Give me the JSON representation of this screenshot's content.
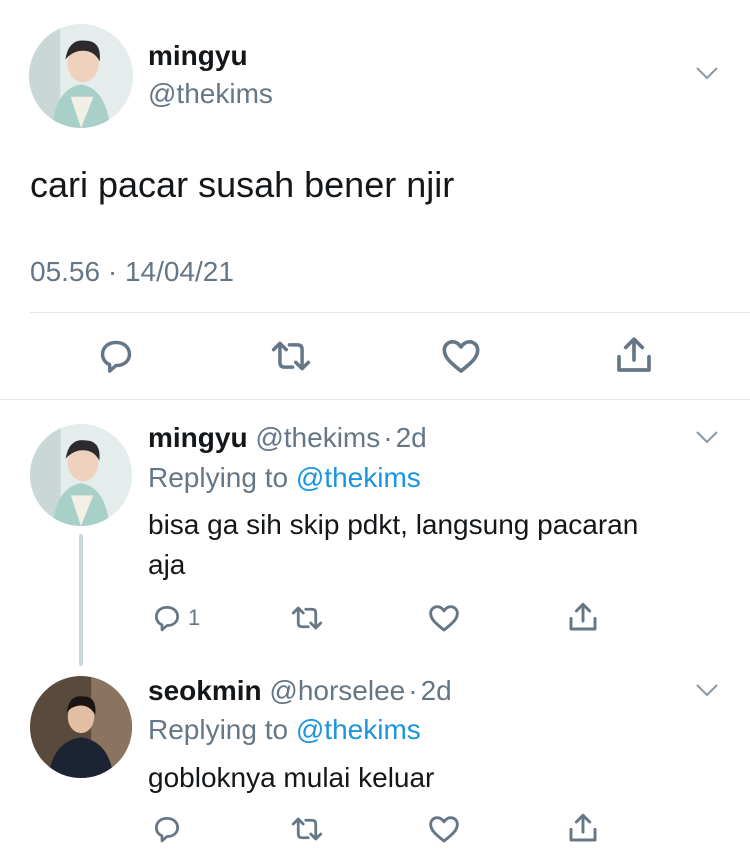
{
  "main_tweet": {
    "display_name": "mingyu",
    "handle": "@thekims",
    "text": "cari pacar susah bener njir",
    "timestamp": "05.56 · 14/04/21"
  },
  "replies": [
    {
      "display_name": "mingyu",
      "handle": "@thekims",
      "sep": "·",
      "time": "2d",
      "replying_prefix": "Replying to",
      "replying_to": "@thekims",
      "text_line1": "bisa ga sih skip pdkt, langsung pacaran",
      "text_line2": "aja",
      "reply_count": "1"
    },
    {
      "display_name": "seokmin",
      "handle": "@horselee",
      "sep": "·",
      "time": "2d",
      "replying_prefix": "Replying to",
      "replying_to": "@thekims",
      "text_line1": "gobloknya mulai keluar"
    }
  ],
  "icons": {
    "reply": "reply-icon",
    "retweet": "retweet-icon",
    "like": "heart-icon",
    "share": "share-icon",
    "more": "chevron-down-icon"
  },
  "colors": {
    "text": "#14171a",
    "secondary": "#657786",
    "link": "#1b95e0",
    "divider": "#e1e8ed",
    "thread_line": "#ccd6dd"
  }
}
